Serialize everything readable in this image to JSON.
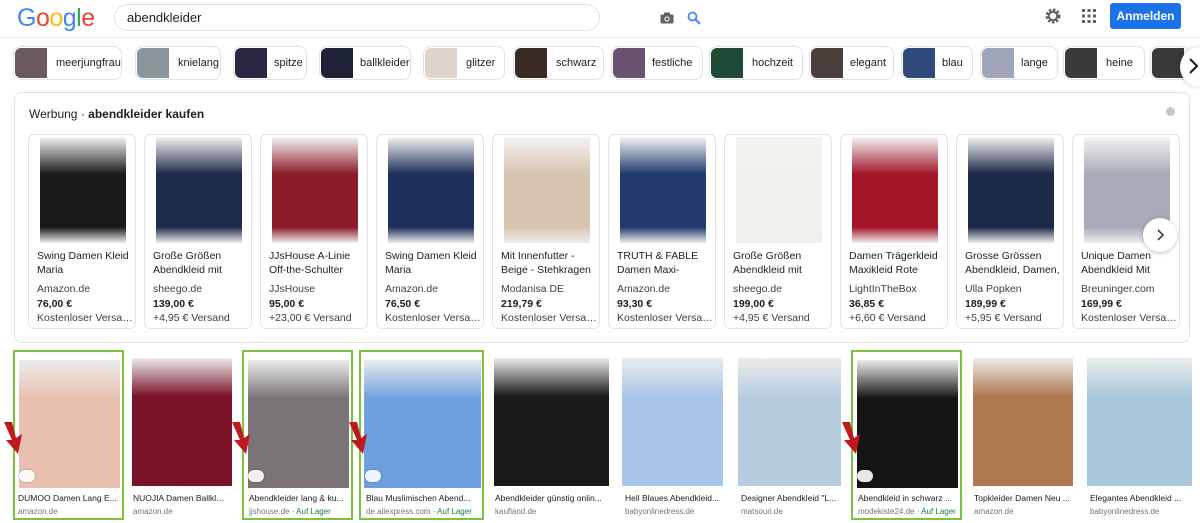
{
  "search": {
    "query": "abendkleider"
  },
  "header": {
    "signin_label": "Anmelden",
    "logo_text": [
      "G",
      "o",
      "o",
      "g",
      "l",
      "e"
    ]
  },
  "colors": {
    "accent": "#1a73e8",
    "highlight": "#7cc242",
    "arrow": "#c0181e",
    "logo": [
      "#4285f4",
      "#ea4335",
      "#fbbc05",
      "#4285f4",
      "#34a853",
      "#ea4335"
    ]
  },
  "chips": [
    {
      "label": "meerjungfrau",
      "thumb": "#6a5a60"
    },
    {
      "label": "knielang",
      "thumb": "#8a9499"
    },
    {
      "label": "spitze",
      "thumb": "#2a2540"
    },
    {
      "label": "ballkleider",
      "thumb": "#1e2236"
    },
    {
      "label": "glitzer",
      "thumb": "#ddd4cc"
    },
    {
      "label": "schwarz",
      "thumb": "#3a2a24"
    },
    {
      "label": "festliche",
      "thumb": "#6a5270"
    },
    {
      "label": "hochzeit",
      "thumb": "#1f4a36"
    },
    {
      "label": "elegant",
      "thumb": "#4a3f3a"
    },
    {
      "label": "blau",
      "thumb": "#2f4a7a"
    },
    {
      "label": "lange",
      "thumb": "#a0a4b8"
    },
    {
      "label": "heine",
      "thumb": "#3a3a3a"
    }
  ],
  "ads": {
    "label": "Werbung",
    "separator": " · ",
    "title": "abendkleider kaufen",
    "products": [
      {
        "title": "Swing Damen Kleid Maria",
        "store": "Amazon.de",
        "price": "76,00 €",
        "shipping": "Kostenloser Versand",
        "color": "#1a1a1a"
      },
      {
        "title": "Große Größen Abendkleid mit",
        "store": "sheego.de",
        "price": "139,00 €",
        "shipping": "+4,95 € Versand",
        "color": "#1e2a4a"
      },
      {
        "title": "JJsHouse A-Linie Off-the-Schulter",
        "store": "JJsHouse",
        "price": "95,00 €",
        "shipping": "+23,00 € Versand",
        "color": "#8c1b2a"
      },
      {
        "title": "Swing Damen Kleid Maria",
        "store": "Amazon.de",
        "price": "76,50 €",
        "shipping": "Kostenloser Versand",
        "color": "#1f2f5c"
      },
      {
        "title": "Mit Innenfutter - Beige - Stehkragen -",
        "store": "Modanisa DE",
        "price": "219,79 €",
        "shipping": "Kostenloser Versand",
        "color": "#d8c4b0"
      },
      {
        "title": "TRUTH & FABLE Damen Maxi-",
        "store": "Amazon.de",
        "price": "93,30 €",
        "shipping": "Kostenloser Versand",
        "color": "#213a6b"
      },
      {
        "title": "Große Größen Abendkleid mit",
        "store": "sheego.de",
        "price": "199,00 €",
        "shipping": "+4,95 € Versand",
        "color": "#f2f0ea"
      },
      {
        "title": "Damen Trägerkleid Maxikleid Rote",
        "store": "LightInTheBox",
        "price": "36,85 €",
        "shipping": "+6,60 € Versand",
        "color": "#a3162a"
      },
      {
        "title": "Grosse Grössen Abendkleid, Damen,",
        "store": "Ulla Popken",
        "price": "189,99 €",
        "shipping": "+5,95 € Versand",
        "color": "#1c2848"
      },
      {
        "title": "Unique Damen Abendkleid Mit",
        "store": "Breuninger.com",
        "price": "169,99 €",
        "shipping": "Kostenloser Versand",
        "color": "#a8abb8"
      }
    ]
  },
  "results": [
    {
      "title": "DUMOO Damen Lang E...",
      "source": "amazon.de",
      "stock": "",
      "highlight": true,
      "arrow": true,
      "color": "#e8c0b0"
    },
    {
      "title": "NUOJIA Damen Ballklei...",
      "source": "amazon.de",
      "stock": "",
      "highlight": false,
      "arrow": false,
      "color": "#7a1228"
    },
    {
      "title": "Abendkleider lang & ku...",
      "source": "jjshouse.de",
      "stock": "Auf Lager",
      "highlight": true,
      "arrow": true,
      "color": "#7a7478"
    },
    {
      "title": "Blau Muslimischen Abend...",
      "source": "de.aliexpress.com",
      "stock": "Auf Lager",
      "highlight": true,
      "arrow": true,
      "color": "#6fa0de"
    },
    {
      "title": "Abendkleider günstig onlin...",
      "source": "kaufland.de",
      "stock": "",
      "highlight": false,
      "arrow": false,
      "color": "#1a1a1a"
    },
    {
      "title": "Hell Blaues Abendkleid...",
      "source": "babyonlinedress.de",
      "stock": "",
      "highlight": false,
      "arrow": false,
      "color": "#a8c6e8"
    },
    {
      "title": "Designer Abendkleid \"L...",
      "source": "matsouri.de",
      "stock": "",
      "highlight": false,
      "arrow": false,
      "color": "#b8cce0"
    },
    {
      "title": "Abendkleid in schwarz ...",
      "source": "modekiste24.de",
      "stock": "Auf Lager",
      "highlight": true,
      "arrow": true,
      "color": "#151515"
    },
    {
      "title": "Topkleider Damen Neu ...",
      "source": "amazon.de",
      "stock": "",
      "highlight": false,
      "arrow": false,
      "color": "#b07850"
    },
    {
      "title": "Elegantes Abendkleid ...",
      "source": "babyonlinedress.de",
      "stock": "",
      "highlight": false,
      "arrow": false,
      "color": "#a8c8dc"
    }
  ]
}
